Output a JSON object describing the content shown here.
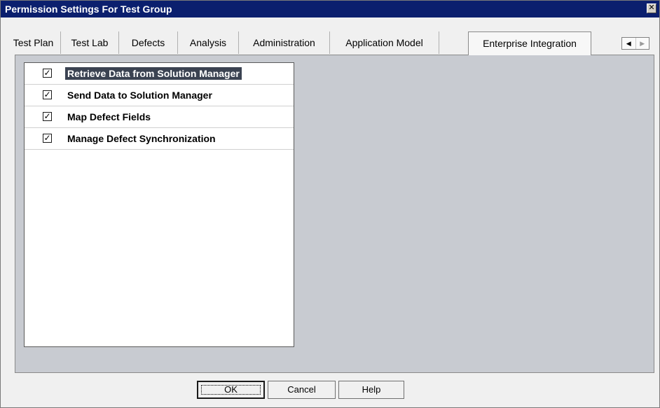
{
  "window": {
    "title": "Permission Settings For Test Group"
  },
  "tabs": [
    {
      "label": "Test Plan",
      "active": false
    },
    {
      "label": "Test Lab",
      "active": false
    },
    {
      "label": "Defects",
      "active": false
    },
    {
      "label": "Analysis",
      "active": false
    },
    {
      "label": "Administration",
      "active": false
    },
    {
      "label": "Application Model",
      "active": false
    },
    {
      "label": "Enterprise Integration",
      "active": true
    }
  ],
  "tab_scroll": {
    "left_icon": "triangle-left-icon",
    "right_icon": "triangle-right-icon",
    "left_glyph": "◀",
    "right_glyph": "▶"
  },
  "permissions": [
    {
      "label": "Retrieve Data from Solution Manager",
      "checked": true,
      "selected": true
    },
    {
      "label": "Send Data to Solution Manager",
      "checked": true,
      "selected": false
    },
    {
      "label": "Map Defect Fields",
      "checked": true,
      "selected": false
    },
    {
      "label": "Manage Defect Synchronization",
      "checked": true,
      "selected": false
    }
  ],
  "check_glyph": "✓",
  "close_glyph": "✕",
  "buttons": {
    "ok": "OK",
    "cancel": "Cancel",
    "help": "Help"
  },
  "colors": {
    "titlebar": "#0b1f6e",
    "panel": "#c8cbd1",
    "selection": "#3b4352"
  }
}
